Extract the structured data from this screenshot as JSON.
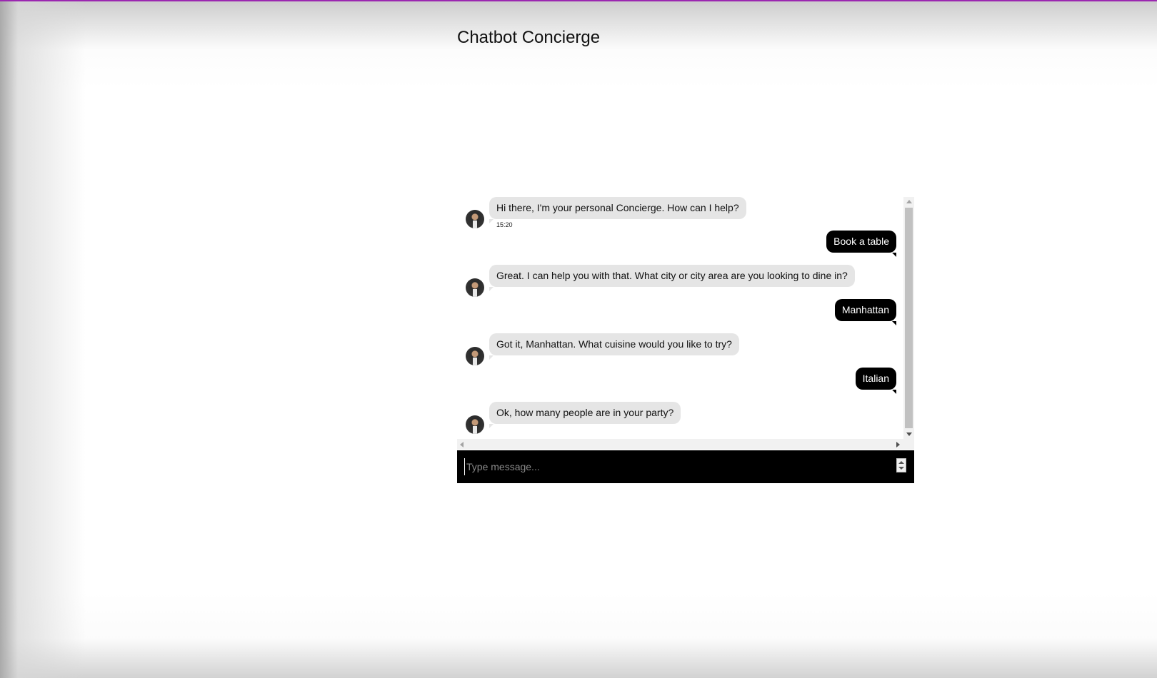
{
  "colors": {
    "accent_line": "#9b27b0",
    "bot_bubble": "#e5e5e5",
    "user_bubble": "#000000",
    "input_bar": "#000000"
  },
  "page": {
    "title": "Chatbot Concierge"
  },
  "chat": {
    "messages": [
      {
        "sender": "bot",
        "text": "Hi there, I'm your personal Concierge. How can I help?",
        "time": "15:20",
        "avatar_icon": "bot-avatar-icon"
      },
      {
        "sender": "user",
        "text": "Book a table"
      },
      {
        "sender": "bot",
        "text": "Great. I can help you with that. What city or city area are you looking to dine in?",
        "avatar_icon": "bot-avatar-icon"
      },
      {
        "sender": "user",
        "text": "Manhattan"
      },
      {
        "sender": "bot",
        "text": "Got it, Manhattan. What cuisine would you like to try?",
        "avatar_icon": "bot-avatar-icon"
      },
      {
        "sender": "user",
        "text": "Italian"
      },
      {
        "sender": "bot",
        "text": "Ok, how many people are in your party?",
        "avatar_icon": "bot-avatar-icon"
      }
    ],
    "input": {
      "placeholder": "Type message...",
      "value": ""
    }
  }
}
